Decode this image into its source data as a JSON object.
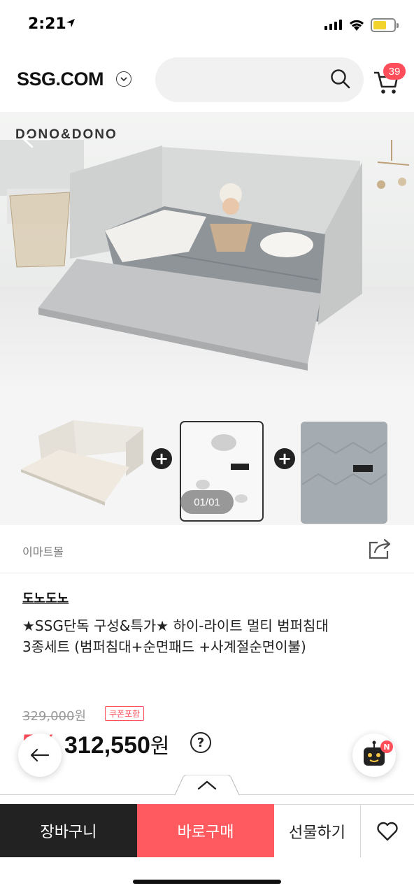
{
  "status_bar": {
    "time": "2:21"
  },
  "header": {
    "logo": "SSG.COM",
    "search_placeholder": "",
    "cart_count": "39"
  },
  "hero": {
    "brand_watermark": "DONO&DONO"
  },
  "thumbnails": {
    "pager": "01/01"
  },
  "seller": {
    "mall_name": "이마트몰"
  },
  "product": {
    "brand": "도노도노",
    "title": "★SSG단독 구성&특가★ 하이-라이트 멀티 범퍼침대 3종세트 (범퍼침대+순면패드 +사계절순면이불)",
    "original_price": "329,000",
    "original_unit": "원",
    "coupon_badge": "쿠폰포함",
    "discount": "5%",
    "price": "312,550",
    "price_unit": "원",
    "help_mark": "?"
  },
  "floating": {
    "chatbot_badge": "N"
  },
  "actions": {
    "cart": "장바구니",
    "buy": "바로구매",
    "gift": "선물하기"
  },
  "colors": {
    "accent": "#ff4d5a",
    "buy_button": "#ff5a5f",
    "cart_button": "#222222"
  }
}
